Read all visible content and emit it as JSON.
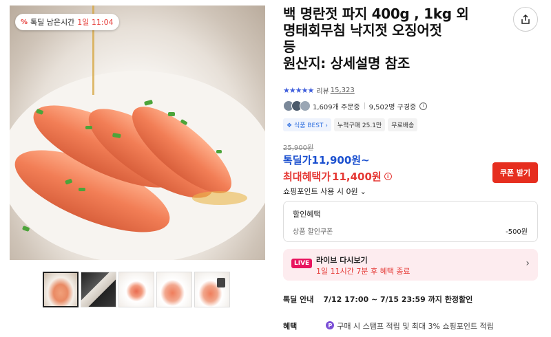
{
  "timer_badge": {
    "icon": "percent-icon",
    "label": "톡딜 남은시간",
    "time": "1일 11:04"
  },
  "product": {
    "title_line1": "백 명란젓 파지 400g , 1kg 외",
    "title_line2": "명태회무침 낙지젓 오징어젓",
    "title_line3": "등",
    "title_line4": "원산지: 상세설명 참조"
  },
  "rating": {
    "stars": "★★★★★",
    "review_label": "리뷰",
    "review_count": "15,323"
  },
  "stats": {
    "orders": "1,609개 주문중",
    "buyers": "9,502명 구경중"
  },
  "tags": [
    "식품 BEST",
    "누적구매 25.1만",
    "무료배송"
  ],
  "price": {
    "original": "25,900원",
    "deal_label": "톡딜가",
    "deal_value": "11,900원~",
    "benefit_label": "최대혜택가",
    "benefit_value": "11,400원",
    "coupon_button": "쿠폰 받기"
  },
  "points": {
    "label": "쇼핑포인트 사용 시 0원"
  },
  "discount": {
    "title": "할인혜택",
    "row_label": "상품 할인쿠폰",
    "row_value": "-500원"
  },
  "live": {
    "badge": "LIVE",
    "title": "라이브 다시보기",
    "subtitle": "1일 11시간 7분 후 혜택 종료"
  },
  "special": {
    "label": "톡딜 안내",
    "value": "7/12 17:00 ~ 7/15 23:59 까지 한정할인"
  },
  "benefit": {
    "label": "혜택",
    "value": "구매 시 스탬프 적립 및 최대 3% 쇼핑포인트 적립"
  },
  "colors": {
    "deal_blue": "#1a4fcf",
    "benefit_red": "#e53935",
    "coupon_red": "#e62e1f",
    "live_pink": "#e8155f"
  }
}
